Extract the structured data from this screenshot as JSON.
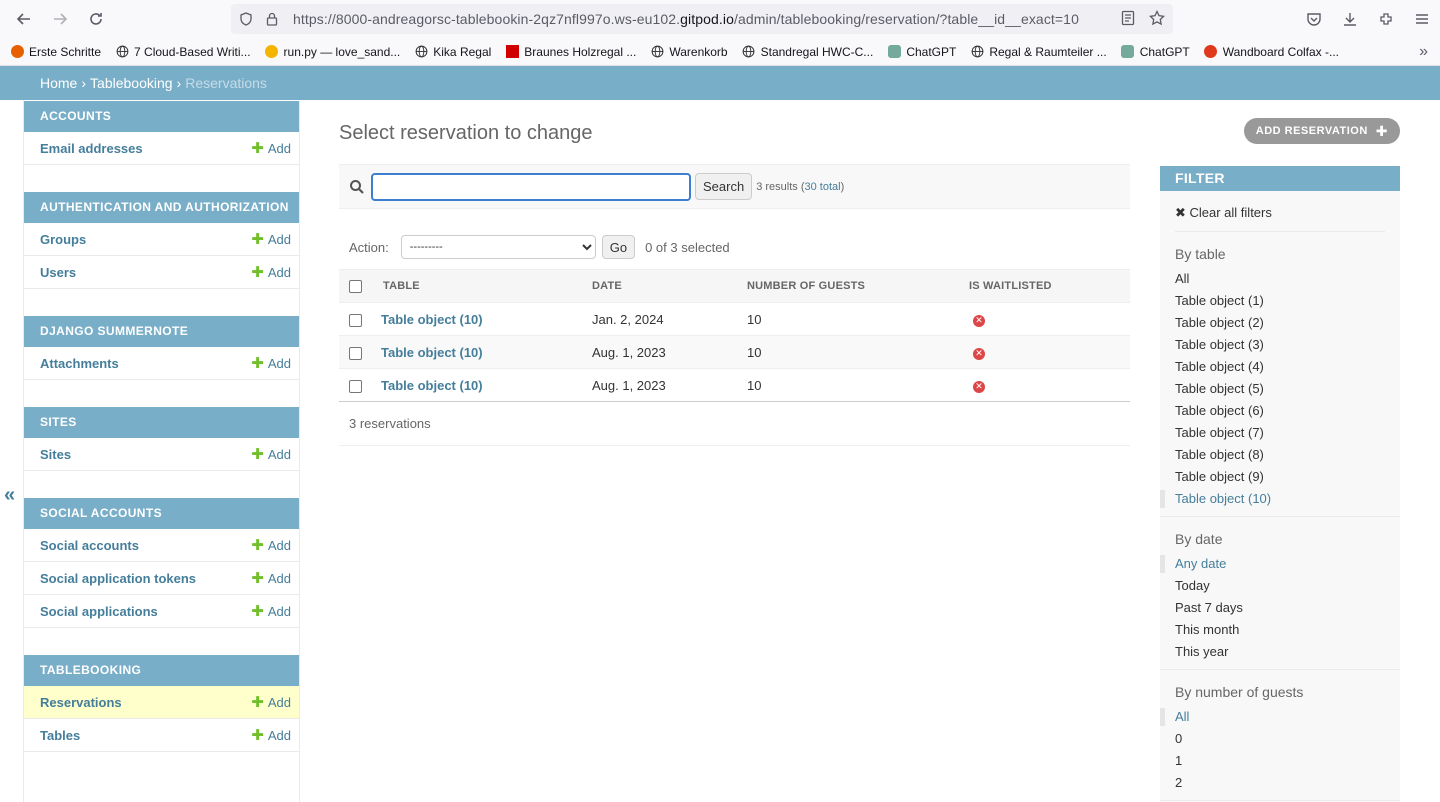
{
  "browser": {
    "url_prefix": "https://8000-andreagorsc-tablebookin-2qz7nfl997o.ws-eu102.",
    "url_domain": "gitpod.io",
    "url_suffix": "/admin/tablebooking/reservation/?table__id__exact=10",
    "bookmarks": [
      {
        "label": "Erste Schritte",
        "icon": "firefox-icon"
      },
      {
        "label": "7 Cloud-Based Writi...",
        "icon": "globe-icon"
      },
      {
        "label": "run.py — love_sand...",
        "icon": "g-icon"
      },
      {
        "label": "Kika Regal",
        "icon": "globe-icon"
      },
      {
        "label": "Braunes Holzregal ...",
        "icon": "k-icon"
      },
      {
        "label": "Warenkorb",
        "icon": "globe-icon"
      },
      {
        "label": "Standregal HWC-C...",
        "icon": "globe-icon"
      },
      {
        "label": "ChatGPT",
        "icon": "chatgpt-icon"
      },
      {
        "label": "Regal & Raumteiler ...",
        "icon": "globe-icon"
      },
      {
        "label": "ChatGPT",
        "icon": "chatgpt-icon"
      },
      {
        "label": "Wandboard Colfax -...",
        "icon": "24-icon"
      }
    ]
  },
  "breadcrumbs": {
    "home": "Home",
    "app": "Tablebooking",
    "current": "Reservations",
    "sep": "›"
  },
  "sidebar": {
    "modules": [
      {
        "caption": "Accounts",
        "rows": [
          {
            "label": "Email addresses",
            "add": "Add"
          }
        ]
      },
      {
        "caption": "Authentication and Authorization",
        "rows": [
          {
            "label": "Groups",
            "add": "Add"
          },
          {
            "label": "Users",
            "add": "Add"
          }
        ]
      },
      {
        "caption": "Django Summernote",
        "rows": [
          {
            "label": "Attachments",
            "add": "Add"
          }
        ]
      },
      {
        "caption": "Sites",
        "rows": [
          {
            "label": "Sites",
            "add": "Add"
          }
        ]
      },
      {
        "caption": "Social Accounts",
        "rows": [
          {
            "label": "Social accounts",
            "add": "Add"
          },
          {
            "label": "Social application tokens",
            "add": "Add"
          },
          {
            "label": "Social applications",
            "add": "Add"
          }
        ]
      },
      {
        "caption": "Tablebooking",
        "rows": [
          {
            "label": "Reservations",
            "add": "Add"
          },
          {
            "label": "Tables",
            "add": "Add"
          }
        ]
      }
    ],
    "collapse": "«"
  },
  "content": {
    "title": "Select reservation to change",
    "add_button": "ADD RESERVATION",
    "search": {
      "value": "",
      "button": "Search",
      "results_prefix": "3 results (",
      "results_link": "30 total",
      "results_suffix": ")"
    },
    "actions": {
      "label": "Action:",
      "selected_option": "---------",
      "go": "Go",
      "count": "0 of 3 selected"
    },
    "table": {
      "headers": [
        "Table",
        "Date",
        "Number of guests",
        "Is waitlisted"
      ],
      "rows": [
        {
          "table": "Table object (10)",
          "date": "Jan. 2, 2024",
          "guests": "10",
          "waitlisted": false
        },
        {
          "table": "Table object (10)",
          "date": "Aug. 1, 2023",
          "guests": "10",
          "waitlisted": false
        },
        {
          "table": "Table object (10)",
          "date": "Aug. 1, 2023",
          "guests": "10",
          "waitlisted": false
        }
      ]
    },
    "paginator": "3 reservations"
  },
  "filter": {
    "title": "FILTER",
    "clear": "✖ Clear all filters",
    "sections": [
      {
        "title": "By table",
        "items": [
          "All",
          "Table object (1)",
          "Table object (2)",
          "Table object (3)",
          "Table object (4)",
          "Table object (5)",
          "Table object (6)",
          "Table object (7)",
          "Table object (8)",
          "Table object (9)",
          "Table object (10)"
        ],
        "selected": 10
      },
      {
        "title": "By date",
        "items": [
          "Any date",
          "Today",
          "Past 7 days",
          "This month",
          "This year"
        ],
        "selected": 0
      },
      {
        "title": "By number of guests",
        "items": [
          "All",
          "0",
          "1",
          "2"
        ],
        "selected": 0
      }
    ]
  },
  "colors": {
    "header": "#79aec8",
    "link": "#447e9b",
    "add_green": "#70bf2b",
    "no_red": "#dd4646",
    "current_row": "#ffffcc"
  }
}
